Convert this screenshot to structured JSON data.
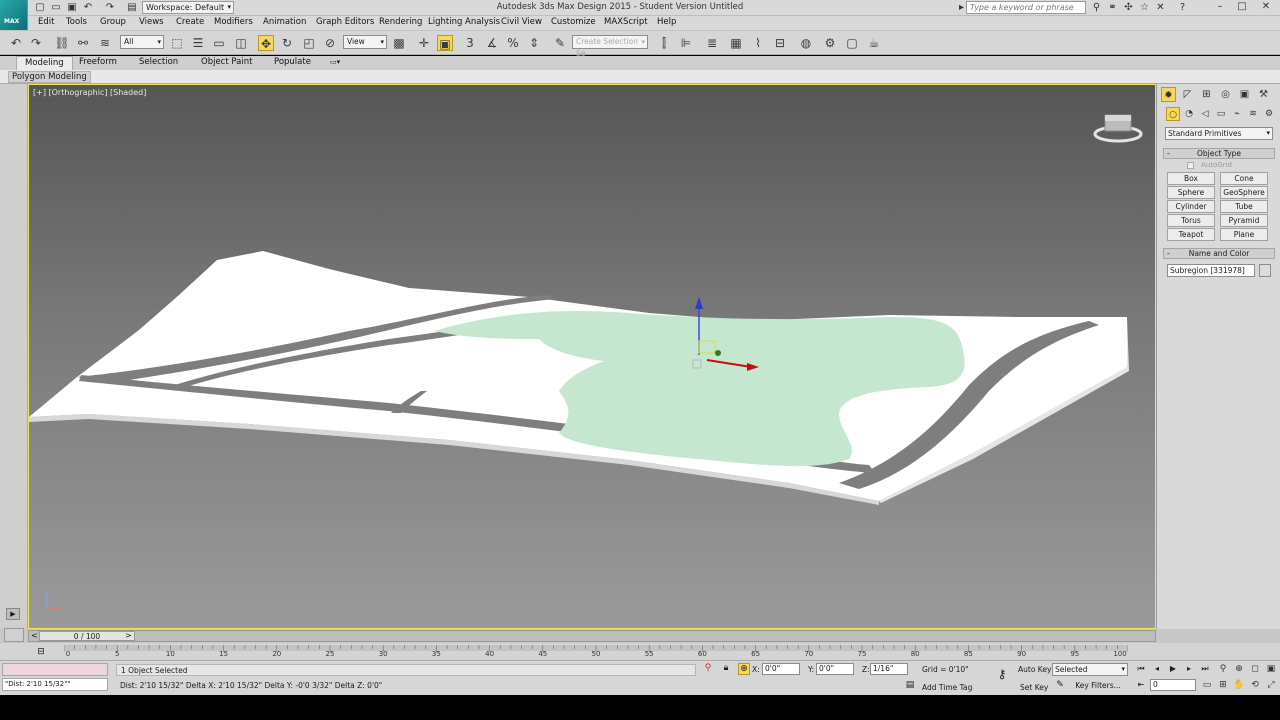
{
  "window": {
    "title": "Autodesk 3ds Max Design 2015 - Student Version   Untitled",
    "app_badge": "MAX",
    "workspace_label": "Workspace: Default",
    "search_placeholder": "Type a keyword or phrase"
  },
  "menu": [
    "Edit",
    "Tools",
    "Group",
    "Views",
    "Create",
    "Modifiers",
    "Animation",
    "Graph Editors",
    "Rendering",
    "Lighting Analysis",
    "Civil View",
    "Customize",
    "MAXScript",
    "Help"
  ],
  "toolbar": {
    "selection_filter": "All",
    "ref_coord": "View",
    "selection_set_placeholder": "Create Selection Se"
  },
  "ribbon": {
    "tabs": [
      "Modeling",
      "Freeform",
      "Selection",
      "Object Paint",
      "Populate"
    ],
    "active_tab": "Modeling",
    "panel_label": "Polygon Modeling"
  },
  "viewport": {
    "label": "[+] [Orthographic] [Shaded]"
  },
  "command_panel": {
    "category_dropdown": "Standard Primitives",
    "object_type_header": "Object Type",
    "autogrid_label": "AutoGrid",
    "primitives": [
      "Box",
      "Cone",
      "Sphere",
      "GeoSphere",
      "Cylinder",
      "Tube",
      "Torus",
      "Pyramid",
      "Teapot",
      "Plane"
    ],
    "name_color_header": "Name and Color",
    "object_name": "Subregion [331978]"
  },
  "timeslider": {
    "position": "0 / 100",
    "left_arrow": "<",
    "right_arrow": ">"
  },
  "trackbar": {
    "ticks": [
      "0",
      "5",
      "10",
      "15",
      "20",
      "25",
      "30",
      "35",
      "40",
      "45",
      "50",
      "55",
      "60",
      "65",
      "70",
      "75",
      "80",
      "85",
      "90",
      "95",
      "100"
    ]
  },
  "status": {
    "maxscript_output": "\"Dist: 2'10 15/32\"\"",
    "selection_info": "1 Object Selected",
    "prompt": "Dist: 2'10 15/32\"  Delta X: 2'10 15/32\"  Delta Y: -0'0 3/32\"  Delta Z: 0'0\"",
    "x_label": "X:",
    "x_value": "0'0\"",
    "y_label": "Y:",
    "y_value": "0'0\"",
    "z_label": "Z:",
    "z_value": "1/16\"",
    "grid": "Grid = 0'10\"",
    "add_time_tag": "Add Time Tag",
    "auto_key": "Auto Key",
    "set_key": "Set Key",
    "key_mode": "Selected",
    "key_filters": "Key Filters...",
    "frame": "0"
  }
}
